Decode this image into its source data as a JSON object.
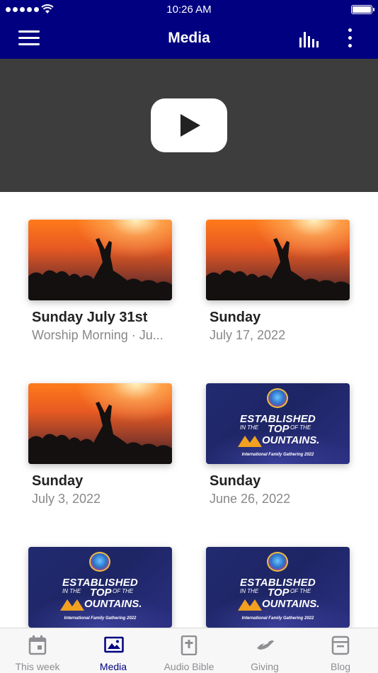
{
  "status_bar": {
    "time": "10:26 AM"
  },
  "nav": {
    "title": "Media"
  },
  "cards": [
    {
      "title": "Sunday July 31st",
      "subtitle": "Worship Morning · Ju...",
      "thumb": "concert"
    },
    {
      "title": "Sunday",
      "subtitle": "July 17, 2022",
      "thumb": "concert"
    },
    {
      "title": "Sunday",
      "subtitle": "July 3, 2022",
      "thumb": "concert"
    },
    {
      "title": "Sunday",
      "subtitle": "June 26, 2022",
      "thumb": "established"
    },
    {
      "title": "",
      "subtitle": "",
      "thumb": "established"
    },
    {
      "title": "",
      "subtitle": "",
      "thumb": "established"
    }
  ],
  "thumb_text": {
    "established": "ESTABLISHED",
    "in_the": "IN THE",
    "top": "TOP",
    "of_the": "OF THE",
    "ountains": "OUNTAINS.",
    "gathering": "International Family Gathering 2022"
  },
  "tabs": [
    {
      "label": "This week",
      "icon": "calendar-icon"
    },
    {
      "label": "Media",
      "icon": "image-icon"
    },
    {
      "label": "Audio Bible",
      "icon": "bible-icon"
    },
    {
      "label": "Giving",
      "icon": "giving-hand-icon"
    },
    {
      "label": "Blog",
      "icon": "archive-icon"
    }
  ],
  "colors": {
    "brand": "#000080",
    "banner": "#3d3d3d",
    "tab_inactive": "#8e8e93"
  }
}
